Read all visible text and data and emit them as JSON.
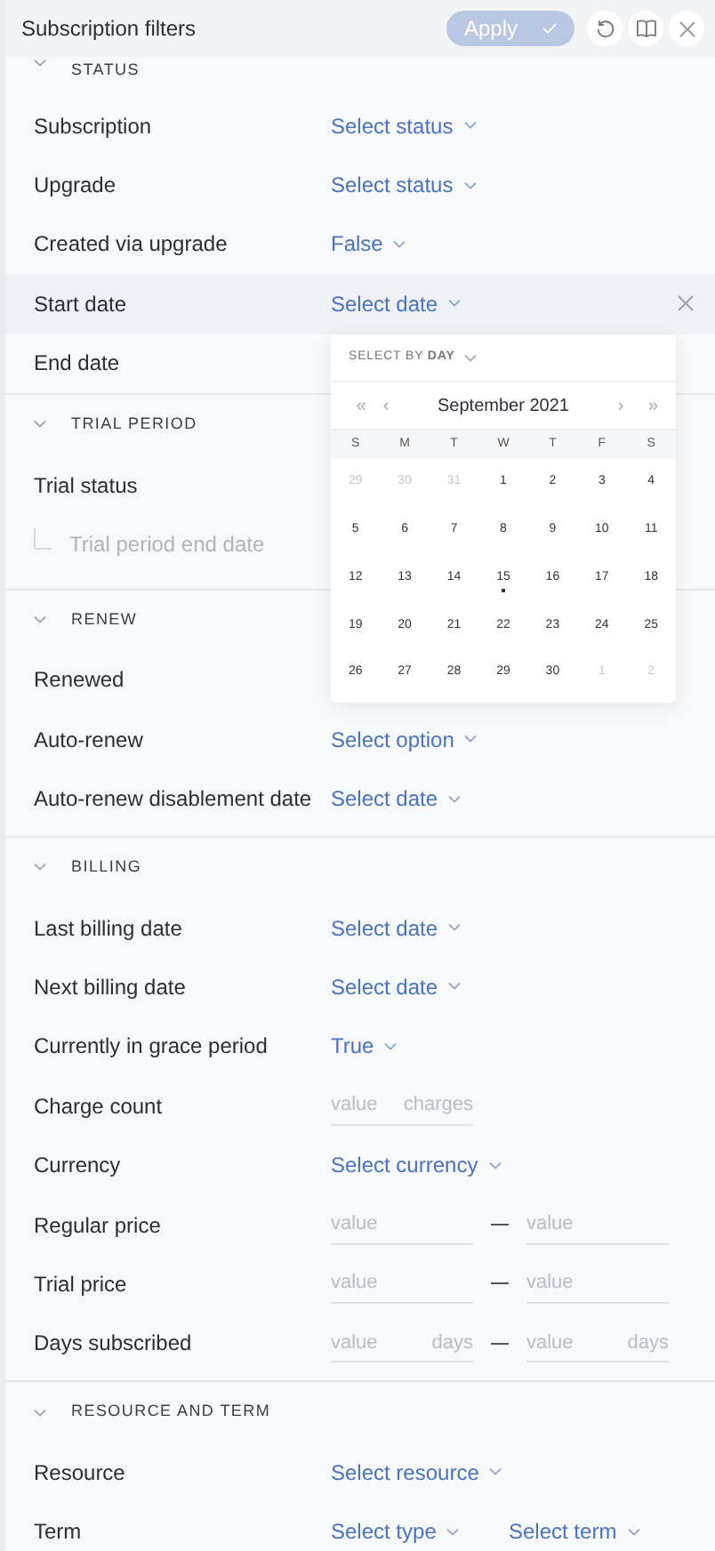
{
  "header": {
    "title": "Subscription filters",
    "apply": {
      "label": "Apply",
      "disabled": true
    }
  },
  "sections": [
    {
      "title": "STATUS",
      "expanded": true,
      "rows": [
        {
          "label": "Subscription",
          "kind": "select",
          "value": "Select status",
          "highlighted": false
        },
        {
          "label": "Upgrade",
          "kind": "select",
          "value": "Select status",
          "highlighted": false
        },
        {
          "label": "Created via upgrade",
          "kind": "select",
          "value": "False",
          "highlighted": false
        },
        {
          "label": "Start date",
          "kind": "select",
          "value": "Select date",
          "highlighted": true
        },
        {
          "label": "End date",
          "kind": "none",
          "highlighted": false
        }
      ]
    },
    {
      "title": "TRIAL PERIOD",
      "expanded": true,
      "rows": [
        {
          "label": "Trial status",
          "kind": "none",
          "highlighted": false,
          "children": [
            {
              "label": "Trial period end date",
              "disabled": true
            }
          ]
        }
      ]
    },
    {
      "title": "RENEW",
      "expanded": true,
      "rows": [
        {
          "label": "Renewed",
          "kind": "none",
          "highlighted": false
        },
        {
          "label": "Auto-renew",
          "kind": "select",
          "value": "Select option",
          "highlighted": false
        },
        {
          "label": "Auto-renew disablement date",
          "kind": "select",
          "value": "Select date",
          "highlighted": false
        }
      ]
    },
    {
      "title": "BILLING",
      "expanded": true,
      "rows": [
        {
          "label": "Last billing date",
          "kind": "select",
          "value": "Select date",
          "highlighted": false
        },
        {
          "label": "Next billing date",
          "kind": "select",
          "value": "Select date",
          "highlighted": false
        },
        {
          "label": "Currently in grace period",
          "kind": "select",
          "value": "True",
          "highlighted": false
        },
        {
          "label": "Charge count",
          "kind": "input",
          "placeholder": "value",
          "suffix": "charges",
          "highlighted": false
        },
        {
          "label": "Currency",
          "kind": "select",
          "value": "Select currency",
          "highlighted": false
        },
        {
          "label": "Regular price",
          "kind": "range",
          "from": {
            "placeholder": "value"
          },
          "to": {
            "placeholder": "value"
          },
          "highlighted": false
        },
        {
          "label": "Trial price",
          "kind": "range",
          "from": {
            "placeholder": "value"
          },
          "to": {
            "placeholder": "value"
          },
          "highlighted": false
        },
        {
          "label": "Days subscribed",
          "kind": "range",
          "from": {
            "placeholder": "value",
            "suffix": "days"
          },
          "to": {
            "placeholder": "value",
            "suffix": "days"
          },
          "highlighted": false
        }
      ]
    },
    {
      "title": "RESOURCE AND TERM",
      "expanded": true,
      "rows": [
        {
          "label": "Resource",
          "kind": "select",
          "value": "Select resource",
          "highlighted": false
        },
        {
          "label": "Term",
          "kind": "selects",
          "values": [
            "Select type",
            "Select term"
          ],
          "highlighted": false
        }
      ]
    }
  ],
  "calendar": {
    "mode": "SELECT BY **DAY**",
    "first": "«",
    "prev": "‹",
    "month": "September 2021",
    "next": "›",
    "last": "»",
    "weekdays": [
      "S",
      "M",
      "T",
      "W",
      "T",
      "F",
      "S"
    ],
    "days": [
      {
        "label": "29",
        "muted": true,
        "today": false
      },
      {
        "label": "30",
        "muted": true,
        "today": false
      },
      {
        "label": "31",
        "muted": true,
        "today": false
      },
      {
        "label": "1",
        "muted": false,
        "today": false
      },
      {
        "label": "2",
        "muted": false,
        "today": false
      },
      {
        "label": "3",
        "muted": false,
        "today": false
      },
      {
        "label": "4",
        "muted": false,
        "today": false
      },
      {
        "label": "5",
        "muted": false,
        "today": false
      },
      {
        "label": "6",
        "muted": false,
        "today": false
      },
      {
        "label": "7",
        "muted": false,
        "today": false
      },
      {
        "label": "8",
        "muted": false,
        "today": false
      },
      {
        "label": "9",
        "muted": false,
        "today": false
      },
      {
        "label": "10",
        "muted": false,
        "today": false
      },
      {
        "label": "11",
        "muted": false,
        "today": false
      },
      {
        "label": "12",
        "muted": false,
        "today": false
      },
      {
        "label": "13",
        "muted": false,
        "today": false
      },
      {
        "label": "14",
        "muted": false,
        "today": false
      },
      {
        "label": "15",
        "muted": false,
        "today": true
      },
      {
        "label": "16",
        "muted": false,
        "today": false
      },
      {
        "label": "17",
        "muted": false,
        "today": false
      },
      {
        "label": "18",
        "muted": false,
        "today": false
      },
      {
        "label": "19",
        "muted": false,
        "today": false
      },
      {
        "label": "20",
        "muted": false,
        "today": false
      },
      {
        "label": "21",
        "muted": false,
        "today": false
      },
      {
        "label": "22",
        "muted": false,
        "today": false
      },
      {
        "label": "23",
        "muted": false,
        "today": false
      },
      {
        "label": "24",
        "muted": false,
        "today": false
      },
      {
        "label": "25",
        "muted": false,
        "today": false
      },
      {
        "label": "26",
        "muted": false,
        "today": false
      },
      {
        "label": "27",
        "muted": false,
        "today": false
      },
      {
        "label": "28",
        "muted": false,
        "today": false
      },
      {
        "label": "29",
        "muted": false,
        "today": false
      },
      {
        "label": "30",
        "muted": false,
        "today": false
      },
      {
        "label": "1",
        "muted": true,
        "today": false
      },
      {
        "label": "2",
        "muted": true,
        "today": false
      }
    ]
  }
}
